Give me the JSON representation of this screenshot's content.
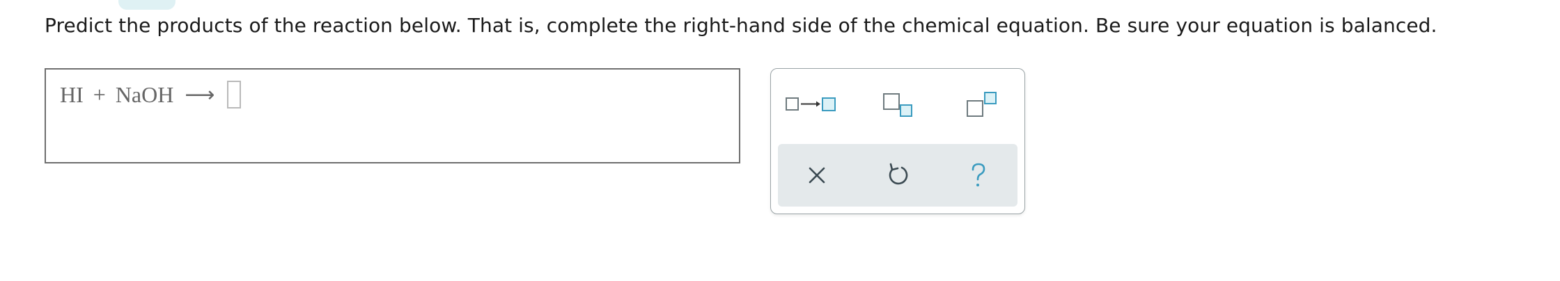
{
  "question": {
    "prompt": "Predict the products of the reaction below. That is, complete the right-hand side of the chemical equation. Be sure your equation is balanced."
  },
  "equation": {
    "reactant1": "HI",
    "plus": "+",
    "reactant2": "NaOH",
    "arrow": "⟶"
  },
  "palette": {
    "tools": [
      {
        "icon": "reaction-arrow-template-icon"
      },
      {
        "icon": "subscript-template-icon"
      },
      {
        "icon": "superscript-template-icon"
      }
    ],
    "actions": [
      {
        "icon": "clear-icon"
      },
      {
        "icon": "undo-icon"
      },
      {
        "icon": "help-icon"
      }
    ]
  },
  "colors": {
    "accent": "#3a9bbf",
    "accent_fill": "#dcf2f7",
    "outline": "#6e7a7e",
    "action_bg": "#e4e9eb",
    "tab": "#dff1f4"
  }
}
